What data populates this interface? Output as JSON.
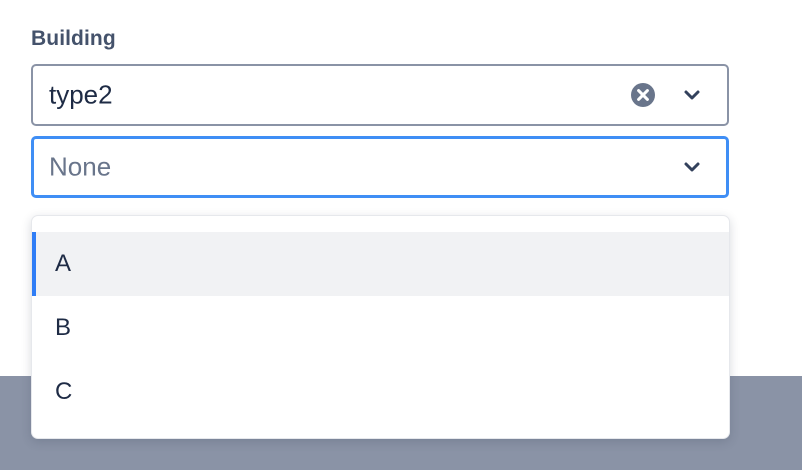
{
  "form": {
    "label": "Building",
    "type_select": {
      "value": "type2",
      "clear_icon": "clear-circle-icon",
      "chevron_icon": "chevron-down-icon"
    },
    "building_select": {
      "placeholder": "None",
      "chevron_icon": "chevron-down-icon",
      "focused": true
    }
  },
  "dropdown": {
    "options": [
      {
        "label": "A",
        "highlighted": true
      },
      {
        "label": "B",
        "highlighted": false
      },
      {
        "label": "C",
        "highlighted": false
      }
    ]
  },
  "colors": {
    "label": "#44526b",
    "text": "#1e2b45",
    "placeholder": "#69758b",
    "border": "#8a93a6",
    "focus": "#3f8ef5",
    "highlight_bar": "#2f7df6",
    "highlight_bg": "#f1f2f4",
    "backdrop": "#8a93a6"
  }
}
